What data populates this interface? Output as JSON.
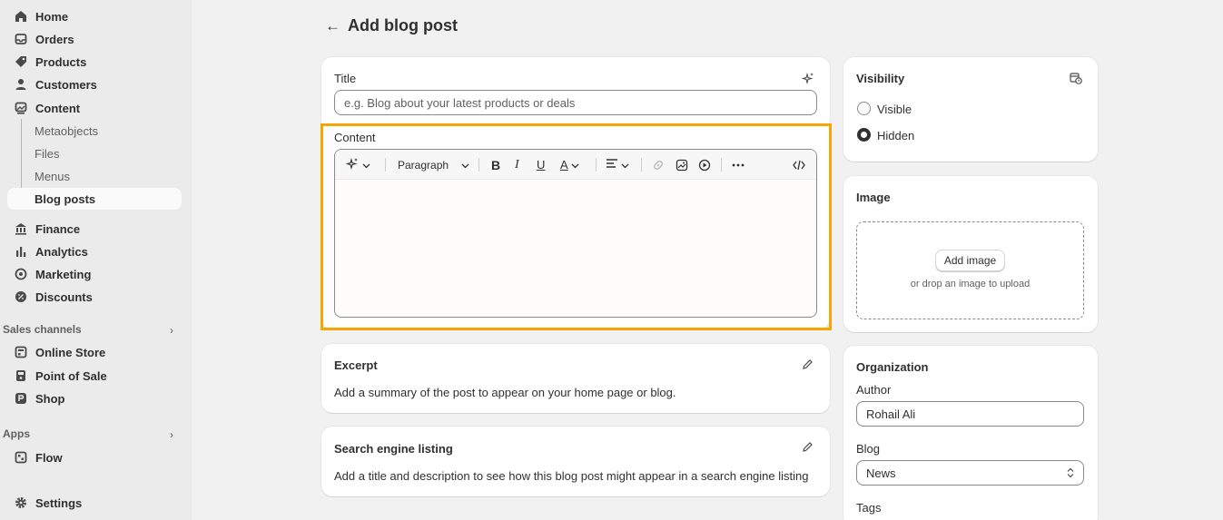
{
  "sidebar": {
    "main_items": [
      {
        "label": "Home",
        "icon": "home-icon"
      },
      {
        "label": "Orders",
        "icon": "inbox-icon"
      },
      {
        "label": "Products",
        "icon": "tag-icon"
      },
      {
        "label": "Customers",
        "icon": "person-icon"
      },
      {
        "label": "Content",
        "icon": "image-icon"
      }
    ],
    "content_sub": [
      "Metaobjects",
      "Files",
      "Menus",
      "Blog posts"
    ],
    "other_items": [
      {
        "label": "Finance",
        "icon": "bank-icon"
      },
      {
        "label": "Analytics",
        "icon": "bar-chart-icon"
      },
      {
        "label": "Marketing",
        "icon": "target-icon"
      },
      {
        "label": "Discounts",
        "icon": "discount-icon"
      }
    ],
    "sales_channels_title": "Sales channels",
    "channels": [
      {
        "label": "Online Store",
        "icon": "store-icon"
      },
      {
        "label": "Point of Sale",
        "icon": "pos-icon"
      },
      {
        "label": "Shop",
        "icon": "shop-icon"
      }
    ],
    "apps_title": "Apps",
    "apps": [
      {
        "label": "Flow",
        "icon": "flow-icon"
      }
    ],
    "settings": "Settings"
  },
  "page": {
    "title": "Add blog post",
    "back_icon": "arrow-left-icon"
  },
  "post": {
    "title_label": "Title",
    "title_placeholder": "e.g. Blog about your latest products or deals",
    "content_label": "Content",
    "paragraph_select": "Paragraph",
    "excerpt_title": "Excerpt",
    "excerpt_desc": "Add a summary of the post to appear on your home page or blog.",
    "seo_title": "Search engine listing",
    "seo_desc": "Add a title and description to see how this blog post might appear in a search engine listing"
  },
  "visibility": {
    "title": "Visibility",
    "options": [
      "Visible",
      "Hidden"
    ],
    "selected": "Hidden"
  },
  "image": {
    "title": "Image",
    "button": "Add image",
    "hint": "or drop an image to upload"
  },
  "organization": {
    "title": "Organization",
    "author_label": "Author",
    "author_value": "Rohail Ali",
    "blog_label": "Blog",
    "blog_value": "News",
    "tags_label": "Tags"
  },
  "colors": {
    "highlight": "#f6a503",
    "sidebar_bg": "#ebebeb",
    "page_bg": "#f1f1f1"
  }
}
